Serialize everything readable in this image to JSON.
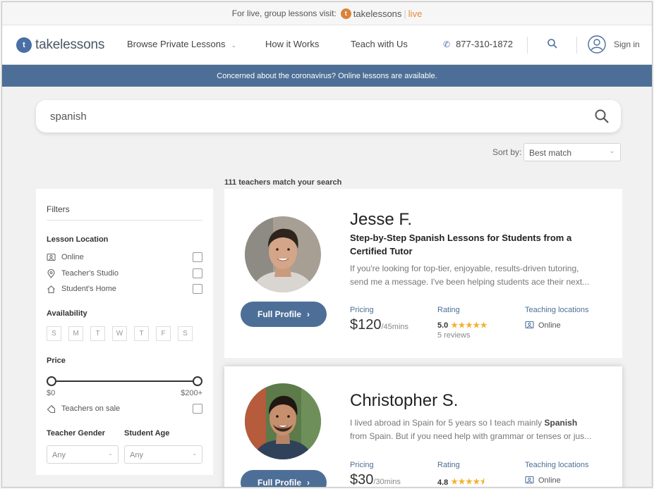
{
  "promo": {
    "text": "For live, group lessons visit:",
    "brand": "takelessons",
    "live": "live"
  },
  "nav": {
    "brand": "takelessons",
    "links": {
      "browse": "Browse Private Lessons",
      "how": "How it Works",
      "teach": "Teach with Us"
    },
    "phone": "877-310-1872",
    "signin": "Sign in"
  },
  "banner": "Concerned about the coronavirus? Online lessons are available.",
  "search": {
    "query": "spanish"
  },
  "sort": {
    "label": "Sort by:",
    "value": "Best match"
  },
  "results_count": "111 teachers match your search",
  "filters": {
    "title": "Filters",
    "lesson_location": {
      "heading": "Lesson Location",
      "options": [
        "Online",
        "Teacher's Studio",
        "Student's Home"
      ]
    },
    "availability": {
      "heading": "Availability",
      "days": [
        "S",
        "M",
        "T",
        "W",
        "T",
        "F",
        "S"
      ]
    },
    "price": {
      "heading": "Price",
      "min_label": "$0",
      "max_label": "$200+",
      "range_min_fraction": 0,
      "range_max_fraction": 1
    },
    "sale": "Teachers on sale",
    "gender": {
      "heading": "Teacher Gender",
      "value": "Any"
    },
    "age": {
      "heading": "Student Age",
      "value": "Any"
    }
  },
  "teachers": [
    {
      "name": "Jesse F.",
      "title": "Step-by-Step Spanish Lessons for Students from a Certified Tutor",
      "desc_line1": "If you're looking for top-tier, enjoyable, results-driven tutoring,",
      "desc_line2": "send me a message. I've been helping students ace their next...",
      "button": "Full Profile",
      "pricing_label": "Pricing",
      "price": "$120",
      "price_unit": "/45mins",
      "rating_label": "Rating",
      "rating": "5.0",
      "stars": 5,
      "reviews": "5 reviews",
      "locations_label": "Teaching locations",
      "location": "Online"
    },
    {
      "name": "Christopher S.",
      "desc_a": "I lived abroad in Spain for 5 years so I teach mainly ",
      "desc_bold": "Spanish",
      "desc_b": "from Spain. But if you need help with grammar or tenses or jus...",
      "button": "Full Profile",
      "pricing_label": "Pricing",
      "price": "$30",
      "price_unit": "/30mins",
      "rating_label": "Rating",
      "rating": "4.8",
      "stars": 4.5,
      "locations_label": "Teaching locations",
      "location": "Online"
    }
  ],
  "colors": {
    "primary": "#4d6f97",
    "star": "#f2b230",
    "live": "#e18a3a"
  }
}
